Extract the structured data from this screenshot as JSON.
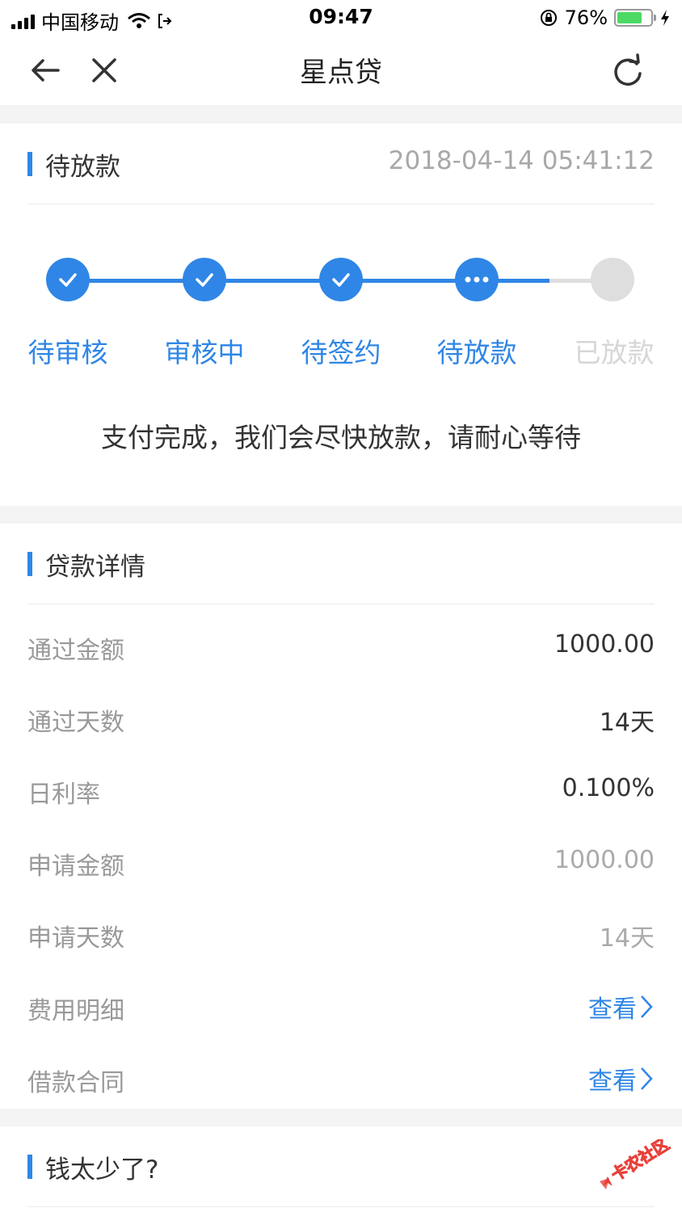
{
  "status": {
    "carrier": "中国移动",
    "time": "09:47",
    "battery": "76%",
    "battery_level": 0.76
  },
  "nav": {
    "title": "星点贷",
    "back_icon": "arrow-left-icon",
    "close_icon": "close-icon",
    "refresh_icon": "refresh-icon"
  },
  "progress": {
    "title": "待放款",
    "timestamp": "2018-04-14 05:41:12",
    "steps": [
      {
        "label": "待审核",
        "state": "done"
      },
      {
        "label": "审核中",
        "state": "done"
      },
      {
        "label": "待签约",
        "state": "done"
      },
      {
        "label": "待放款",
        "state": "current"
      },
      {
        "label": "已放款",
        "state": "pending"
      }
    ],
    "message": "支付完成，我们会尽快放款，请耐心等待"
  },
  "details": {
    "title": "贷款详情",
    "rows": [
      {
        "label": "通过金额",
        "value": "1000.00"
      },
      {
        "label": "通过天数",
        "value": "14天"
      },
      {
        "label": "日利率",
        "value": "0.100%"
      },
      {
        "label": "申请金额",
        "value": "1000.00"
      },
      {
        "label": "申请天数",
        "value": "14天"
      },
      {
        "label": "费用明细",
        "value": "查看"
      },
      {
        "label": "借款合同",
        "value": "查看"
      }
    ]
  },
  "more": {
    "title": "钱太少了?"
  },
  "watermark": {
    "text": "卡农社区"
  },
  "colors": {
    "accent": "#2f86e6",
    "pending": "#dedede"
  }
}
